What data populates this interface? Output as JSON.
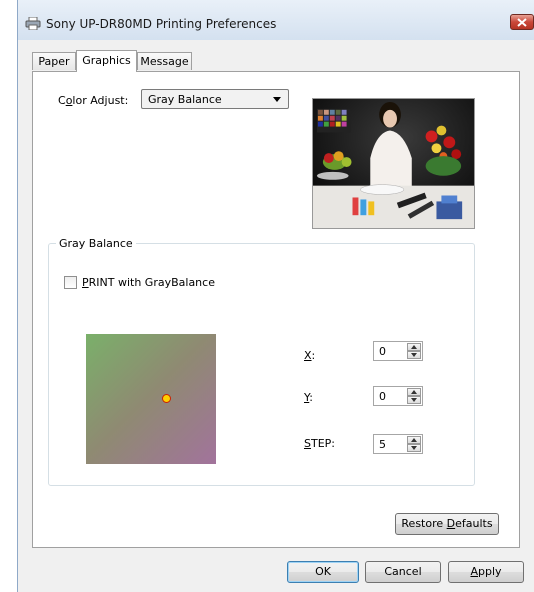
{
  "window": {
    "title": "Sony UP-DR80MD Printing Preferences",
    "icons": {
      "app": "printer-icon",
      "close": "close-icon"
    },
    "colors": {
      "close": "#c9483a",
      "accent": "#3c7fb1"
    }
  },
  "tabs": [
    {
      "label": "Paper",
      "active": false
    },
    {
      "label": "Graphics",
      "active": true
    },
    {
      "label": "Message",
      "active": false
    }
  ],
  "color_adjust": {
    "label_pre": "C",
    "label_u": "o",
    "label_post": "lor Adjust:",
    "selected": "Gray Balance"
  },
  "gray_balance": {
    "legend": "Gray Balance",
    "checkbox_u": "P",
    "checkbox_rest": "RINT with GrayBalance",
    "checked": false,
    "x": {
      "label_u": "X",
      "label_rest": ":",
      "value": "0"
    },
    "y": {
      "label_u": "Y",
      "label_rest": ":",
      "value": "0"
    },
    "step": {
      "label_u": "S",
      "label_rest": "TEP:",
      "value": "5"
    }
  },
  "restore": {
    "pre": "Restore ",
    "u": "D",
    "post": "efaults"
  },
  "buttons": {
    "ok": "OK",
    "cancel": "Cancel",
    "apply_u": "A",
    "apply_rest": "pply"
  }
}
